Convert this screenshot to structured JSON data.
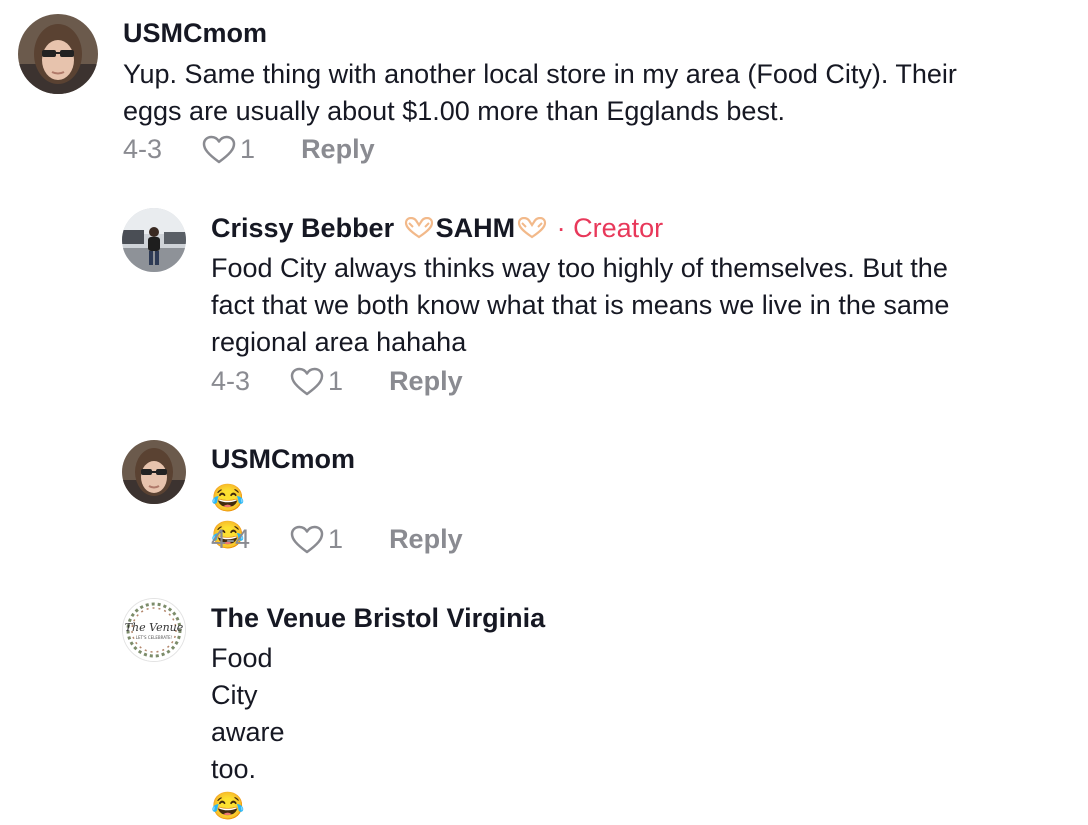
{
  "comments": [
    {
      "username": "USMCmom",
      "text_line1": "Yup. Same thing with another local store in my area (Food City). Their",
      "text_line2": "eggs are usually about $1.00 more than Egglands best.",
      "date": "4-3",
      "likes": "1",
      "reply_label": "Reply"
    },
    {
      "username_part1": "Crissy Bebber ",
      "username_part2": "SAHM",
      "creator_sep": " · ",
      "creator_label": "Creator",
      "text_line1": "Food City always thinks way too highly of themselves. But the",
      "text_line2": "fact that we both know what that is means we live in the same",
      "text_line3": "regional area hahaha",
      "date": "4-3",
      "likes": "1",
      "reply_label": "Reply"
    },
    {
      "username": "USMCmom",
      "text": "😂😂",
      "date": "4-4",
      "likes": "1",
      "reply_label": "Reply"
    },
    {
      "username": "The Venue Bristol Virginia",
      "text": "Food City aware too. 😂",
      "avatar_text_main": "The Venue",
      "avatar_text_sub": "LET'S CELEBRATE!"
    }
  ],
  "icons": {
    "like": "heart-outline-icon",
    "heart_hands": "heart-hands-emoji",
    "laugh": "tears-of-joy-emoji"
  },
  "colors": {
    "text": "#161823",
    "meta": "#8a8b91",
    "creator": "#e8385a"
  }
}
